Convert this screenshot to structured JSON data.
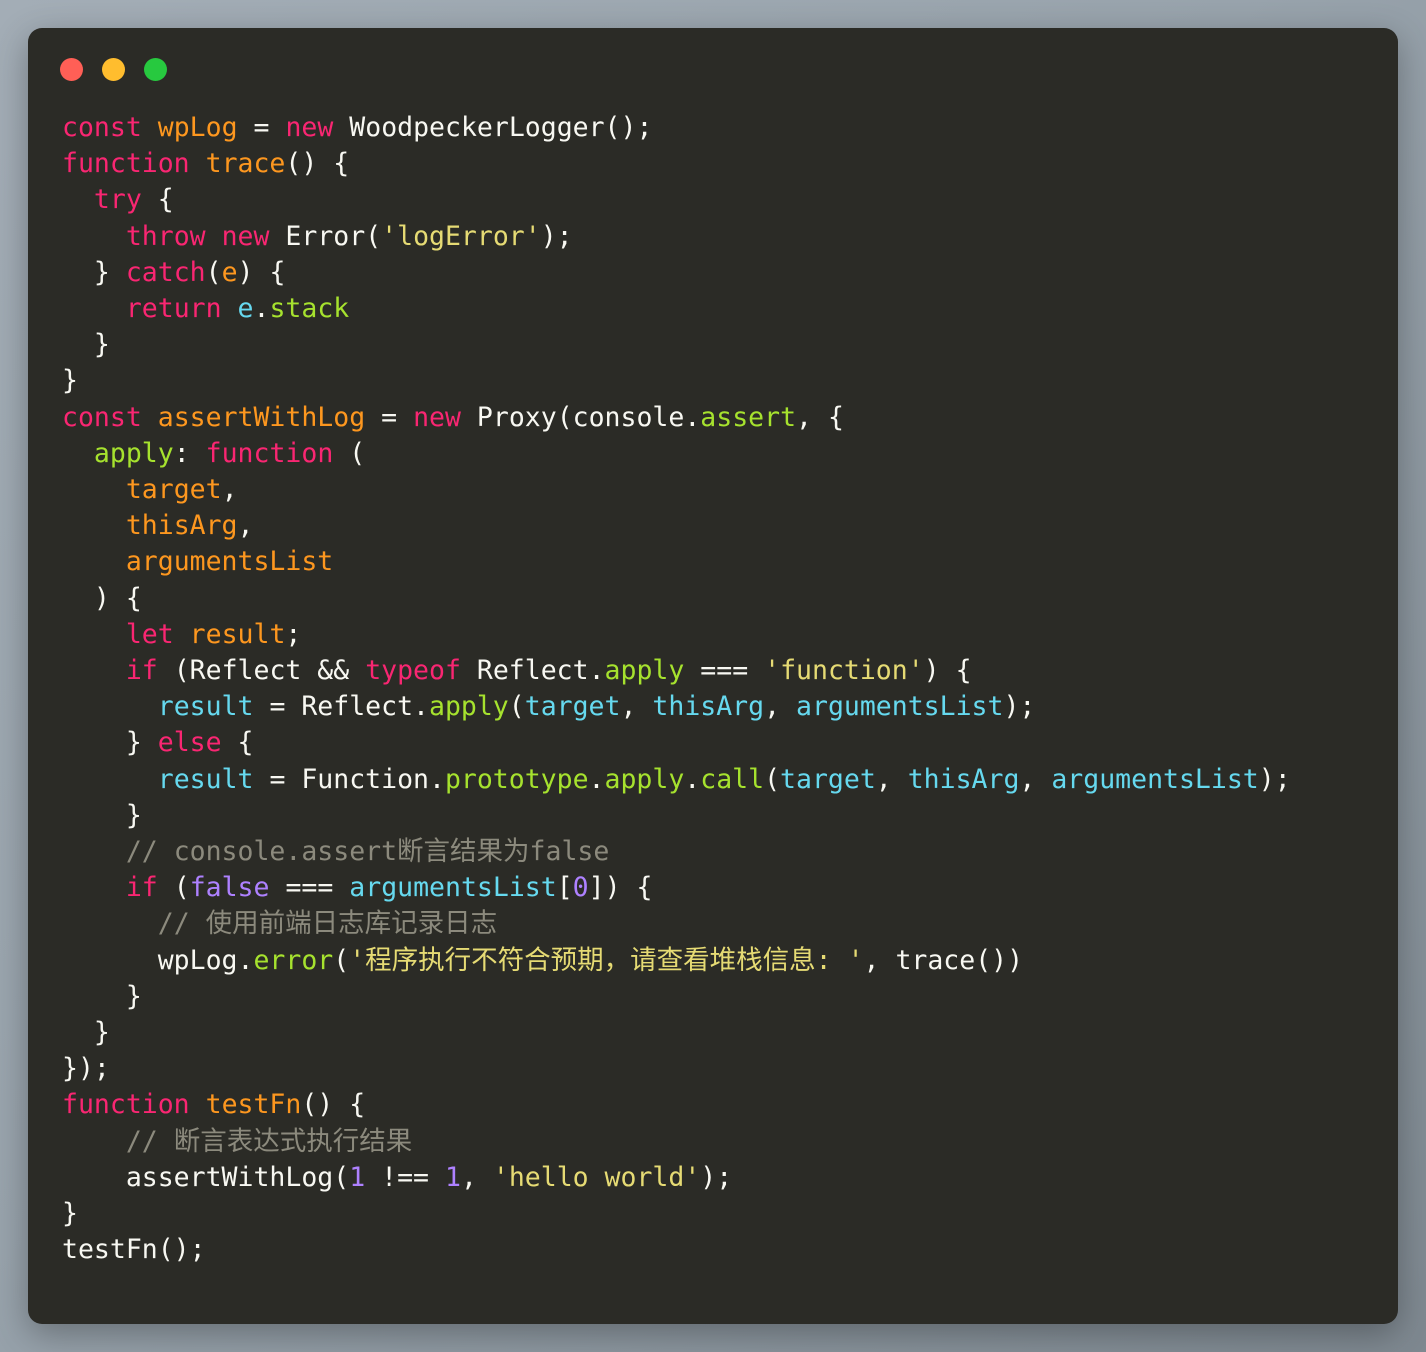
{
  "window": {
    "title": "",
    "controls": [
      {
        "name": "close",
        "color": "#ff5f56"
      },
      {
        "name": "minimize",
        "color": "#ffbd2e"
      },
      {
        "name": "maximize",
        "color": "#27c93f"
      }
    ]
  },
  "theme": {
    "background": "#2b2b26",
    "desktop_background": "#98a3ac",
    "foreground": "#f8f8f2",
    "keyword": "#f92672",
    "variable": "#fd971f",
    "reference": "#66d9ef",
    "property": "#a6e22e",
    "string": "#e6db74",
    "number": "#ae81ff",
    "comment": "#8c8a7d"
  },
  "editor": {
    "language": "javascript",
    "font_size_px": 26.5,
    "line_height_px": 36.2,
    "indent_spaces": 2,
    "line_numbers_visible": false,
    "total_lines": 32
  },
  "code": {
    "plain_text": "const wpLog = new WoodpeckerLogger();\nfunction trace() {\n  try {\n    throw new Error('logError');\n  } catch(e) {\n    return e.stack\n  }\n}\nconst assertWithLog = new Proxy(console.assert, {\n  apply: function (\n    target,\n    thisArg,\n    argumentsList\n  ) {\n    let result;\n    if (Reflect && typeof Reflect.apply === 'function') {\n      result = Reflect.apply(target, thisArg, argumentsList);\n    } else {\n      result = Function.prototype.apply.call(target, thisArg, argumentsList);\n    }\n    // console.assert断言结果为false\n    if (false === argumentsList[0]) {\n      // 使用前端日志库记录日志\n      wpLog.error('程序执行不符合预期，请查看堆栈信息: ', trace())\n    }\n  }\n});\nfunction testFn() {\n    // 断言表达式执行结果\n    assertWithLog(1 !== 1, 'hello world');\n}\ntestFn();",
    "lines": [
      {
        "n": 1,
        "text": "const wpLog = new WoodpeckerLogger();"
      },
      {
        "n": 2,
        "text": "function trace() {"
      },
      {
        "n": 3,
        "text": "  try {"
      },
      {
        "n": 4,
        "text": "    throw new Error('logError');"
      },
      {
        "n": 5,
        "text": "  } catch(e) {"
      },
      {
        "n": 6,
        "text": "    return e.stack"
      },
      {
        "n": 7,
        "text": "  }"
      },
      {
        "n": 8,
        "text": "}"
      },
      {
        "n": 9,
        "text": "const assertWithLog = new Proxy(console.assert, {"
      },
      {
        "n": 10,
        "text": "  apply: function ("
      },
      {
        "n": 11,
        "text": "    target,"
      },
      {
        "n": 12,
        "text": "    thisArg,"
      },
      {
        "n": 13,
        "text": "    argumentsList"
      },
      {
        "n": 14,
        "text": "  ) {"
      },
      {
        "n": 15,
        "text": "    let result;"
      },
      {
        "n": 16,
        "text": "    if (Reflect && typeof Reflect.apply === 'function') {"
      },
      {
        "n": 17,
        "text": "      result = Reflect.apply(target, thisArg, argumentsList);"
      },
      {
        "n": 18,
        "text": "    } else {"
      },
      {
        "n": 19,
        "text": "      result = Function.prototype.apply.call(target, thisArg, argumentsList);"
      },
      {
        "n": 20,
        "text": "    }"
      },
      {
        "n": 21,
        "text": "    // console.assert断言结果为false"
      },
      {
        "n": 22,
        "text": "    if (false === argumentsList[0]) {"
      },
      {
        "n": 23,
        "text": "      // 使用前端日志库记录日志"
      },
      {
        "n": 24,
        "text": "      wpLog.error('程序执行不符合预期，请查看堆栈信息: ', trace())"
      },
      {
        "n": 25,
        "text": "    }"
      },
      {
        "n": 26,
        "text": "  }"
      },
      {
        "n": 27,
        "text": "});"
      },
      {
        "n": 28,
        "text": "function testFn() {"
      },
      {
        "n": 29,
        "text": "    // 断言表达式执行结果"
      },
      {
        "n": 30,
        "text": "    assertWithLog(1 !== 1, 'hello world');"
      },
      {
        "n": 31,
        "text": "}"
      },
      {
        "n": 32,
        "text": "testFn();"
      }
    ],
    "comments": [
      "// console.assert断言结果为false",
      "// 使用前端日志库记录日志",
      "// 断言表达式执行结果"
    ],
    "strings": [
      "'logError'",
      "'function'",
      "'程序执行不符合预期，请查看堆栈信息: '",
      "'hello world'"
    ],
    "identifiers": [
      "wpLog",
      "WoodpeckerLogger",
      "trace",
      "Error",
      "e",
      "stack",
      "assertWithLog",
      "Proxy",
      "console",
      "assert",
      "apply",
      "target",
      "thisArg",
      "argumentsList",
      "result",
      "Reflect",
      "Function",
      "prototype",
      "call",
      "error",
      "testFn"
    ]
  }
}
